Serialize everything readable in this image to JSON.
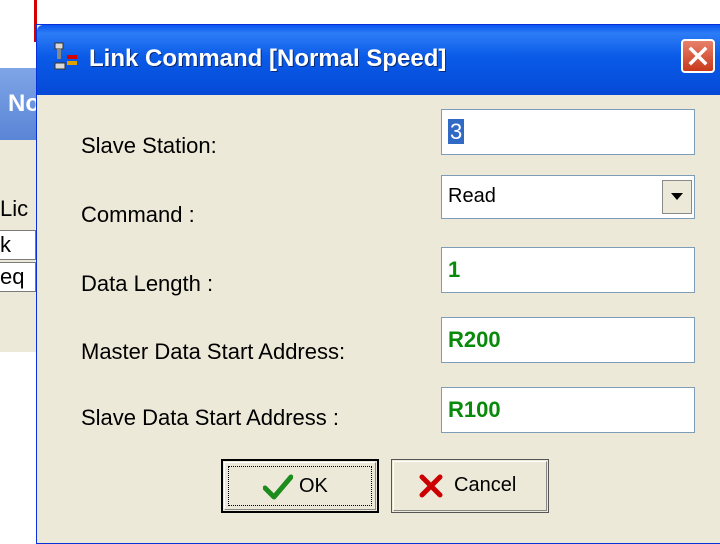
{
  "background": {
    "tab_text": "No",
    "rows": [
      "Lic",
      "k",
      "eq"
    ]
  },
  "dialog": {
    "title": "Link Command [Normal Speed]",
    "title_icon": "network-link-icon",
    "close_icon": "close-icon",
    "fields": {
      "slave_station": {
        "label": "Slave Station:",
        "value": "3"
      },
      "command": {
        "label": "Command :",
        "value": "Read"
      },
      "data_length": {
        "label": "Data Length :",
        "value": "1"
      },
      "master_start": {
        "label": "Master Data Start Address:",
        "value": "R200"
      },
      "slave_start": {
        "label": "Slave Data Start Address :",
        "value": "R100"
      }
    },
    "buttons": {
      "ok": {
        "label": "OK",
        "icon": "checkmark-icon"
      },
      "cancel": {
        "label": "Cancel",
        "icon": "x-cross-icon"
      }
    }
  },
  "colors": {
    "titlebar": "#0a5be8",
    "face": "#ece9d8",
    "value_green": "#0a8a0a",
    "selection": "#316ac5"
  }
}
